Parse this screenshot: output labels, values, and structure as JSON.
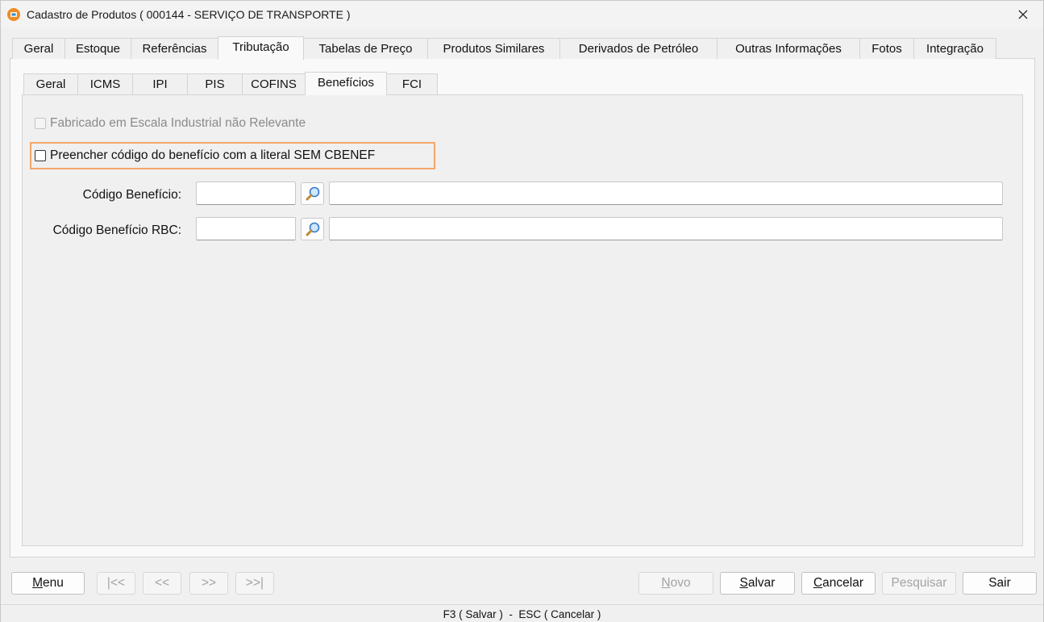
{
  "window": {
    "title": "Cadastro de Produtos ( 000144 - SERVIÇO DE TRANSPORTE )",
    "icon": "app-logo-icon",
    "close_icon": "close-icon"
  },
  "outer_tabs": [
    {
      "label": "Geral",
      "active": false
    },
    {
      "label": "Estoque",
      "active": false
    },
    {
      "label": "Referências",
      "active": false
    },
    {
      "label": "Tributação",
      "active": true
    },
    {
      "label": "Tabelas de Preço",
      "active": false
    },
    {
      "label": "Produtos Similares",
      "active": false
    },
    {
      "label": "Derivados de Petróleo",
      "active": false
    },
    {
      "label": "Outras Informações",
      "active": false
    },
    {
      "label": "Fotos",
      "active": false
    },
    {
      "label": "Integração",
      "active": false
    }
  ],
  "inner_tabs": [
    {
      "label": "Geral",
      "active": false
    },
    {
      "label": "ICMS",
      "active": false
    },
    {
      "label": "IPI",
      "active": false
    },
    {
      "label": "PIS",
      "active": false
    },
    {
      "label": "COFINS",
      "active": false
    },
    {
      "label": "Benefícios",
      "active": true
    },
    {
      "label": "FCI",
      "active": false
    }
  ],
  "beneficios": {
    "fabricado_escala_label": "Fabricado em Escala Industrial não Relevante",
    "preencher_sem_cbenef_label": "Preencher código do benefício com a literal SEM CBENEF",
    "codigo_beneficio_label": "Código Benefício:",
    "codigo_beneficio_rbc_label": "Código Benefício RBC:",
    "codigo_beneficio_value": "",
    "codigo_beneficio_desc": "",
    "codigo_beneficio_rbc_value": "",
    "codigo_beneficio_rbc_desc": "",
    "lookup_icon": "magnifier-icon",
    "highlight_color": "#f4a66a"
  },
  "footer": {
    "menu_pre": "",
    "menu_ul": "M",
    "menu_post": "enu",
    "first": "|<<",
    "prev": "<<",
    "next": ">>",
    "last": ">>|",
    "novo_ul": "N",
    "novo_post": "ovo",
    "salvar_ul": "S",
    "salvar_post": "alvar",
    "cancelar_ul": "C",
    "cancelar_post": "ancelar",
    "pesquisar": "Pesquisar",
    "sair": "Sair"
  },
  "status": {
    "shortcuts": "F3 ( Salvar )  -  ESC ( Cancelar )"
  }
}
